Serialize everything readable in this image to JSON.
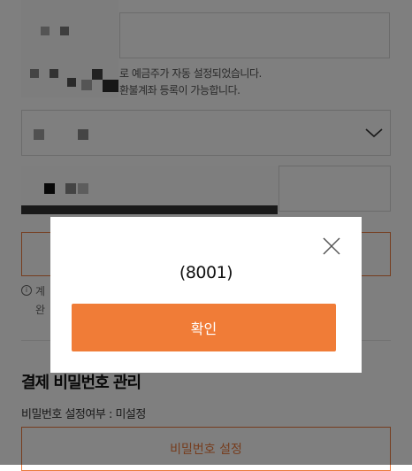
{
  "form": {
    "account_notice_1": "로 예금주가 자동 설정되었습니다.",
    "account_notice_2": "환불계좌 등록이 가능합니다.",
    "bank_select_icon": "chevron-down-icon",
    "info_icon": "info-icon",
    "info_text_1": "계",
    "info_text_2": "완"
  },
  "password_section": {
    "title": "결제 비밀번호 관리",
    "status": "비밀번호 설정여부 : 미설정",
    "button_label": "비밀번호 설정"
  },
  "modal": {
    "message": "(8001)",
    "confirm_label": "확인",
    "close_icon": "close-icon"
  },
  "colors": {
    "accent": "#f07c37",
    "overlay": "rgba(0,0,0,0.5)"
  }
}
